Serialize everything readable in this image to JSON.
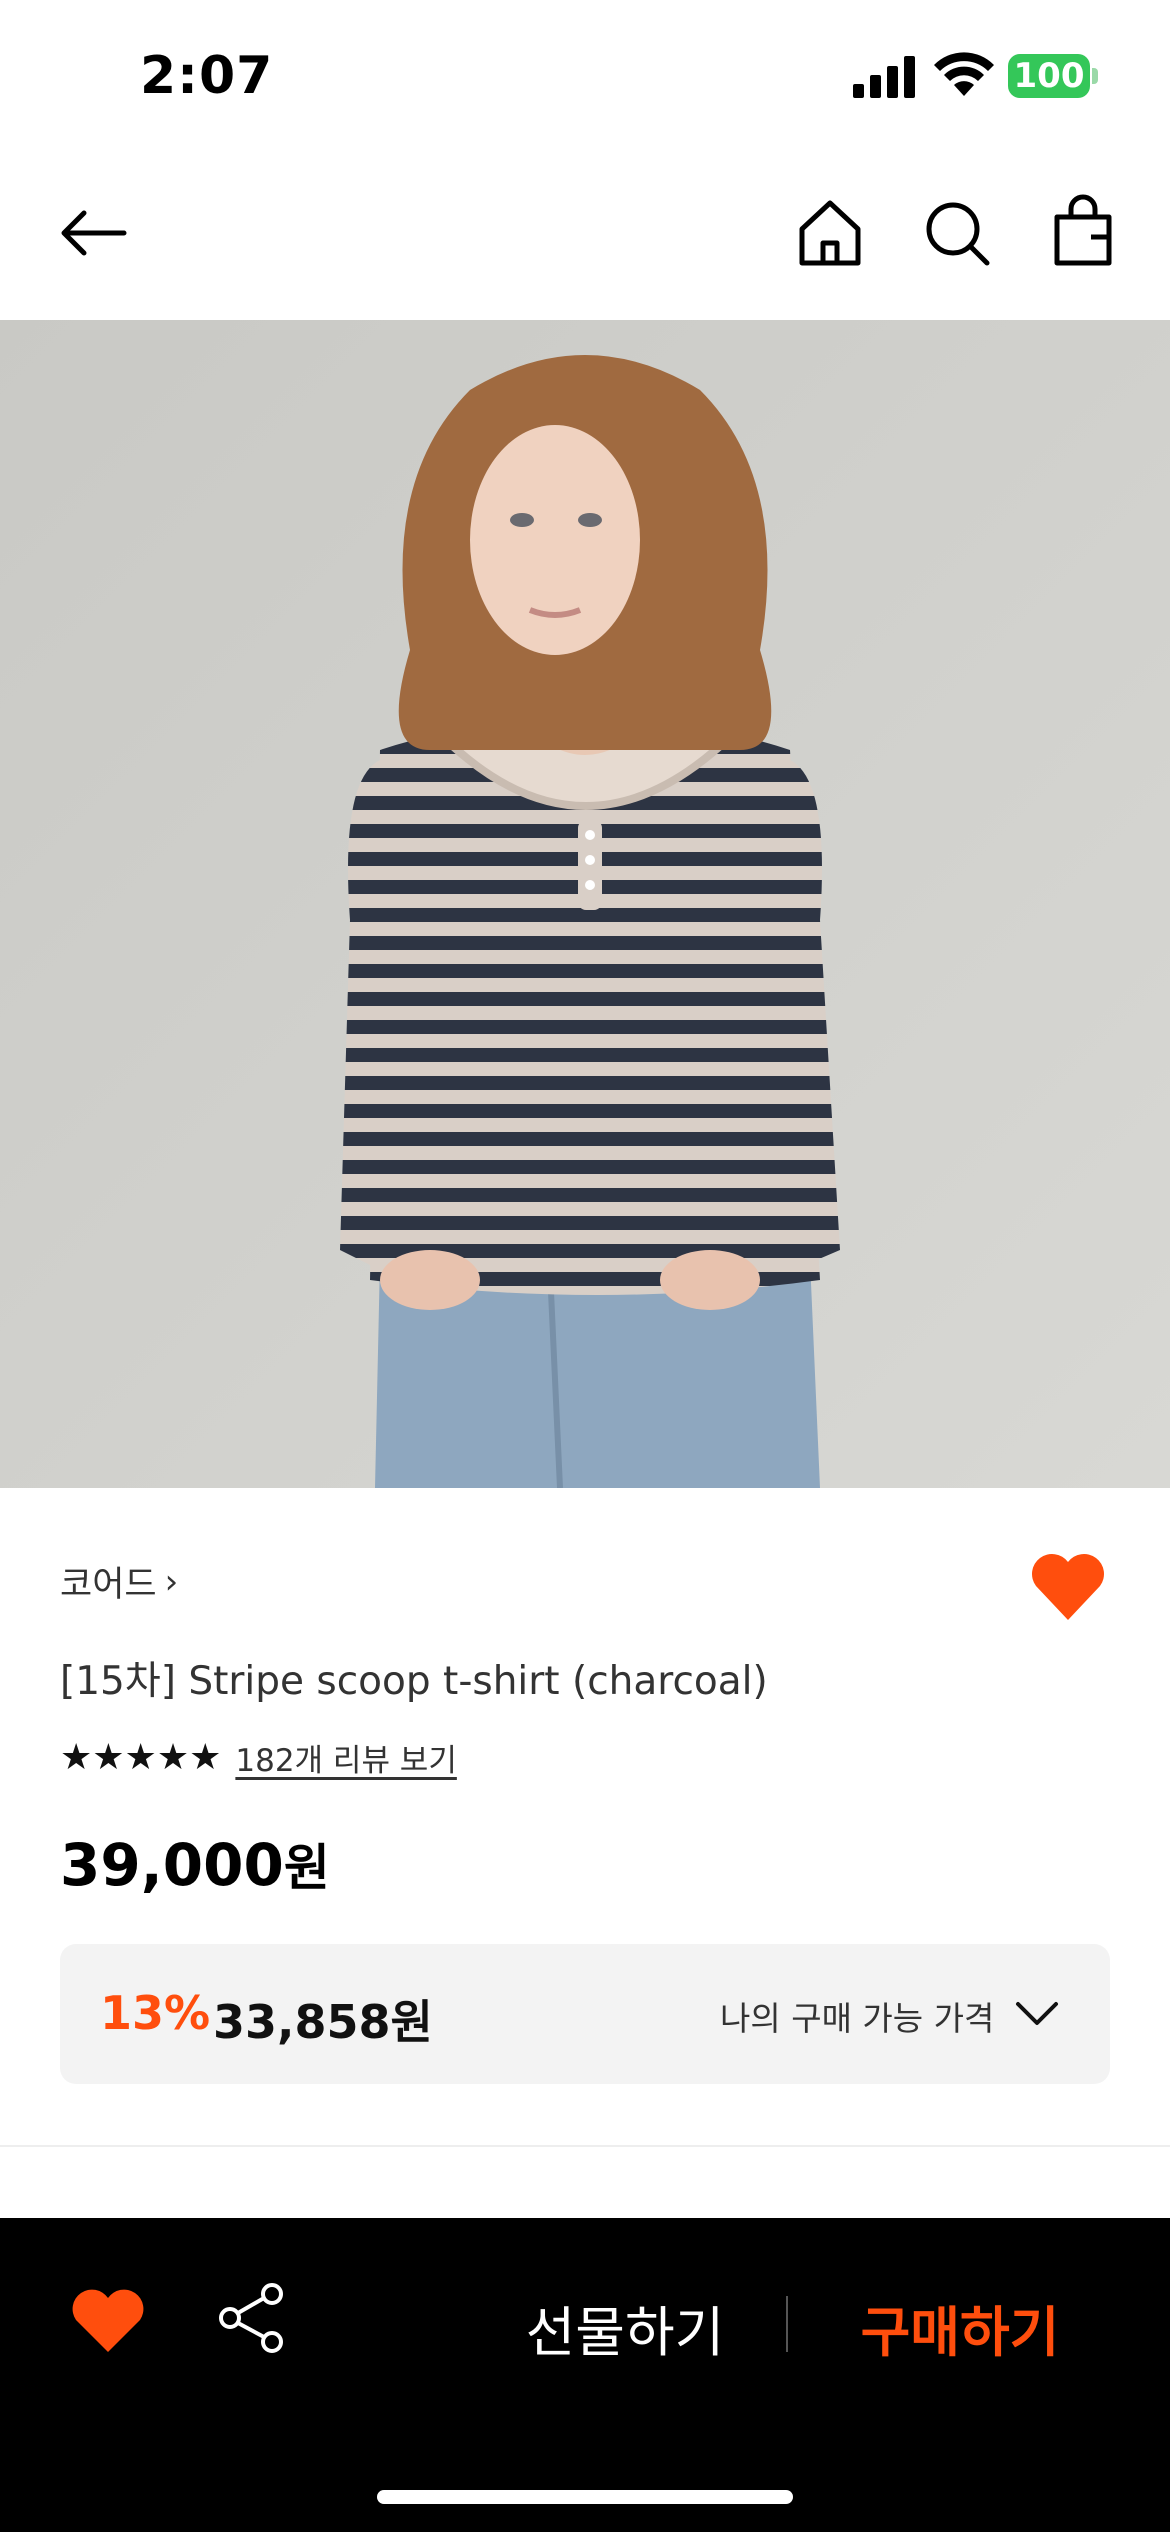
{
  "status_bar": {
    "time": "2:07",
    "battery": "100"
  },
  "nav": {
    "back_icon": "arrow-left-icon",
    "home_icon": "home-icon",
    "search_icon": "search-icon",
    "bag_icon": "shopping-bag-icon"
  },
  "product": {
    "brand": "코어드",
    "title": "[15차] Stripe scoop t-shirt (charcoal)",
    "stars": "★★★★★",
    "review_link": "182개 리뷰 보기",
    "price_number": "39,000",
    "price_unit": "원",
    "rating": 5
  },
  "discount": {
    "rate": "13%",
    "price": "33,858원",
    "label": "나의 구매 가능 가격"
  },
  "bottom_bar": {
    "gift_label": "선물하기",
    "buy_label": "구매하기"
  },
  "colors": {
    "accent": "#ff4e0d",
    "battery": "#34c759"
  }
}
